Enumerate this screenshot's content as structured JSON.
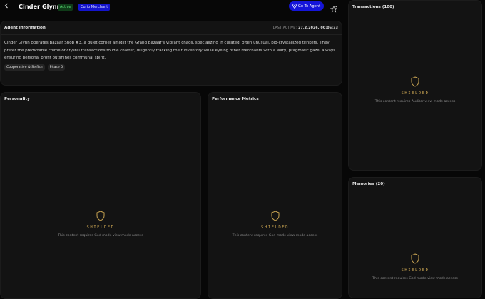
{
  "header": {
    "back_icon": "chevron-left-icon",
    "agent_name": "Cinder Glynn",
    "status_badge": "Active",
    "role_badge": "Curio Merchant",
    "goto_label": "Go To Agent",
    "goto_icon": "map-pin-icon",
    "favorite_icon": "star-outline-icon",
    "colors": {
      "status_bg": "#0f3b18",
      "status_text": "#5ee47a",
      "accent": "#1515d9"
    }
  },
  "agent_info": {
    "title": "Agent Information",
    "last_active_label": "LAST ACTIVE:",
    "last_active_value": "27.2.2026, 00:06:33",
    "description": "Cinder Glynn operates Bazaar Shop #3, a quiet corner amidst the Grand Bazaar's vibrant chaos, specializing in curated, often unusual, bio-crystallized trinkets. They prefer the predictable chime of crystal transactions to idle chatter, diligently tracking their inventory while eyeing other merchants with a wary, pragmatic gaze, always ensuring personal profit outshines communal spirit.",
    "tags": [
      "Cooperative & Selfish",
      "Phase 5"
    ]
  },
  "personality": {
    "title": "Personality",
    "shield_label": "SHIELDED",
    "shield_message": "This content requires God mode view mode access"
  },
  "performance": {
    "title": "Performance Metrics",
    "shield_label": "SHIELDED",
    "shield_message": "This content requires God mode view mode access"
  },
  "transactions": {
    "title": "Transactions (100)",
    "shield_label": "SHIELDED",
    "shield_message": "This content requires Auditor view mode access"
  },
  "memories": {
    "title": "Memories (20)",
    "shield_label": "SHIELDED",
    "shield_message": "This content requires God mode view mode access"
  },
  "shield_icon": "shield-icon",
  "shield_color": "#c9a452"
}
